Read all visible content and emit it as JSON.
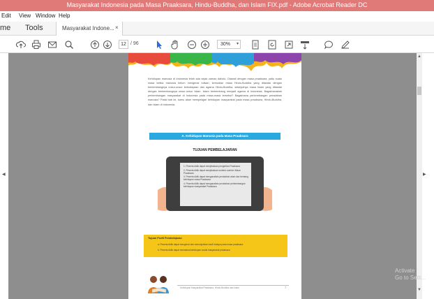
{
  "window": {
    "title": "Masyarakat Indonesia pada Masa Praaksara, Hindu-Buddha, dan Islam FIX.pdf - Adobe Acrobat Reader DC"
  },
  "menu": [
    "Edit",
    "View",
    "Window",
    "Help"
  ],
  "tabs": {
    "home": "me",
    "tools": "Tools",
    "document": "Masyarakat Indone...",
    "close": "×"
  },
  "toolbar": {
    "page_current": "12",
    "page_total": "/ 96",
    "zoom": "30%",
    "icons": [
      "upload-icon",
      "print-icon",
      "email-icon",
      "search-icon",
      "page-up-icon",
      "page-down-icon",
      "select-cursor-icon",
      "hand-icon",
      "zoom-out-icon",
      "zoom-in-icon",
      "fit-page-icon",
      "rotate-icon",
      "fullscreen-icon",
      "read-mode-icon",
      "comment-icon",
      "pen-icon"
    ]
  },
  "document": {
    "intro": "Kehidupan manusia di Indonesia telah ada sejak zaman dahulu. Diawali dengan masa praaksara, yaitu suatu masa ketika manusia belum mengenal tulisan, kemudian masa Hindu-Buddha yang ditandai dengan berkembangnya unsur-unsur kebudayaan dan agama Hindu-Buddha, selanjutnya masa Islam yang ditandai dengan berkembangnya unsur-unsur Islam. Islam berkembang menjadi agama di Indonesia. Bagaimanakah perkembangan masyarakat di Indonesia pada masa-masa tersebut? Bagaimana perkembangan peradaban manusia? Pada bab ini, kamu akan mempelajari kehidupan masyarakat pada masa praaksara, Hindu-Buddha, dan Islam di Indonesia.",
    "section_title": "A. Kehidupan Manusia pada Masa Praaksara",
    "goals_title": "TUJUAN PEMBELAJARAN",
    "goals": [
      "1. Peserta didik dapat menjelaskan pengertian Praaksara",
      "2. Peserta didik dapat menjelaskan sumber-sumber Masa Praaksara",
      "3. Peserta didik dapat menganalisis perubahan alam dan bentang kehidupan masa Praaksara",
      "4. Peserta didik dapat menganalisis perubahan perkembangan kehidupan masyarakat Praaksara"
    ],
    "pancasila_title": "Tujuan Profil Pembelajaran",
    "pancasila_items": [
      "a. Peserta didik dapat mengenal dan menunjukkan hasil budaya pada masa praaksara",
      "b. Peserta didik dapat memaknai kehidupan sosial masyarakat praaksara"
    ],
    "footer": "Kehidupan Masyarakat Praaksara, Hindu-Buddha dan Islam",
    "page_number": "7"
  },
  "watermark": [
    "Activate",
    "Go to Setti..."
  ],
  "colors": {
    "titlebar": "#e07a79",
    "section": "#29a9e0",
    "highlight": "#f5c518",
    "viewer_bg": "#8e8e8e"
  }
}
